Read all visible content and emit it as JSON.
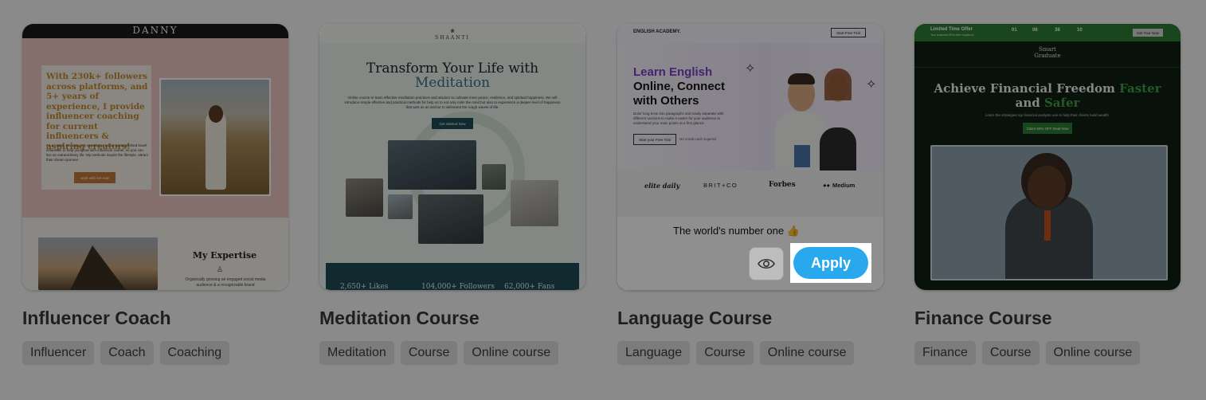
{
  "cards": [
    {
      "title": "Influencer Coach",
      "tags": [
        "Influencer",
        "Coach",
        "Coaching"
      ],
      "preview": {
        "brand": "DANNY",
        "headline": "With 230k+ followers across platforms, and 5+ years of experience, I provide influencer coaching for current influencers & aspiring creators!",
        "body": "As a coach, I'm using my experience as an accomplished travel influencer to help you grow with influencer career, so you can live an extraordinary life. My methods inspire the lifestyle, attract their dream sponsor.",
        "cta": "work with me now",
        "section_title": "My Expertise",
        "section_text": "Organically growing an engaged social media audience & a recognizable brand"
      }
    },
    {
      "title": "Meditation Course",
      "tags": [
        "Meditation",
        "Course",
        "Online course"
      ],
      "preview": {
        "brand": "SHAANTI",
        "headline_1": "Transform Your Life with",
        "headline_2": "Meditation",
        "body": "Online course to learn effective meditation practices and wisdom to cultivate inner peace, resilience, and spiritual happiness. We will introduce simple effective and practical methods for help us to not only calm the mind but also to experience a deeper level of happiness that acts as an anchor to withstand the rough waves of life.",
        "cta": "Get Started Now",
        "stats": [
          "2,650+ Likes",
          "104,000+ Followers",
          "62,000+ Fans"
        ]
      }
    },
    {
      "title": "Language Course",
      "tags": [
        "Language",
        "Course",
        "Online course"
      ],
      "preview": {
        "brand": "ENGLISH ACADEMY.",
        "nav_button": "Start Free Trial",
        "headline_1": "Learn English",
        "headline_2": "Online, Connect",
        "headline_3": "with Others",
        "body": "Dolor long texts into paragraphs and easily separate with different sections to make it easier for your audience to understand your main points at a first glance.",
        "cta": "Start your Free Trial",
        "cta_note": "No credit card required",
        "logos": [
          "elite daily",
          "BRIT+CO",
          "Forbes",
          "Medium"
        ],
        "subheading": "The world's number one 👍"
      },
      "actions": {
        "apply_label": "Apply",
        "preview_icon": "eye-icon"
      }
    },
    {
      "title": "Finance Course",
      "tags": [
        "Finance",
        "Course",
        "Online course"
      ],
      "preview": {
        "offer_title": "Limited Time Offer",
        "offer_sub": "Your exclusive 50% offer expires in:",
        "timer": [
          "01",
          "06",
          "38",
          "10"
        ],
        "nav_button": "Get Your Now",
        "brand_1": "Smart",
        "brand_2": "Graduate",
        "headline_1": "Achieve Financial Freedom",
        "headline_green_1": "Faster",
        "headline_2": "and",
        "headline_green_2": "Safer",
        "body": "Learn the strategies top financial analysts use to help their clients build wealth.",
        "cta": "Claim 50% OFF Deal Now"
      }
    }
  ],
  "colors": {
    "accent_blue": "#29a8ee",
    "finance_green": "#2e7d32",
    "meditation_teal": "#1f4b55"
  }
}
